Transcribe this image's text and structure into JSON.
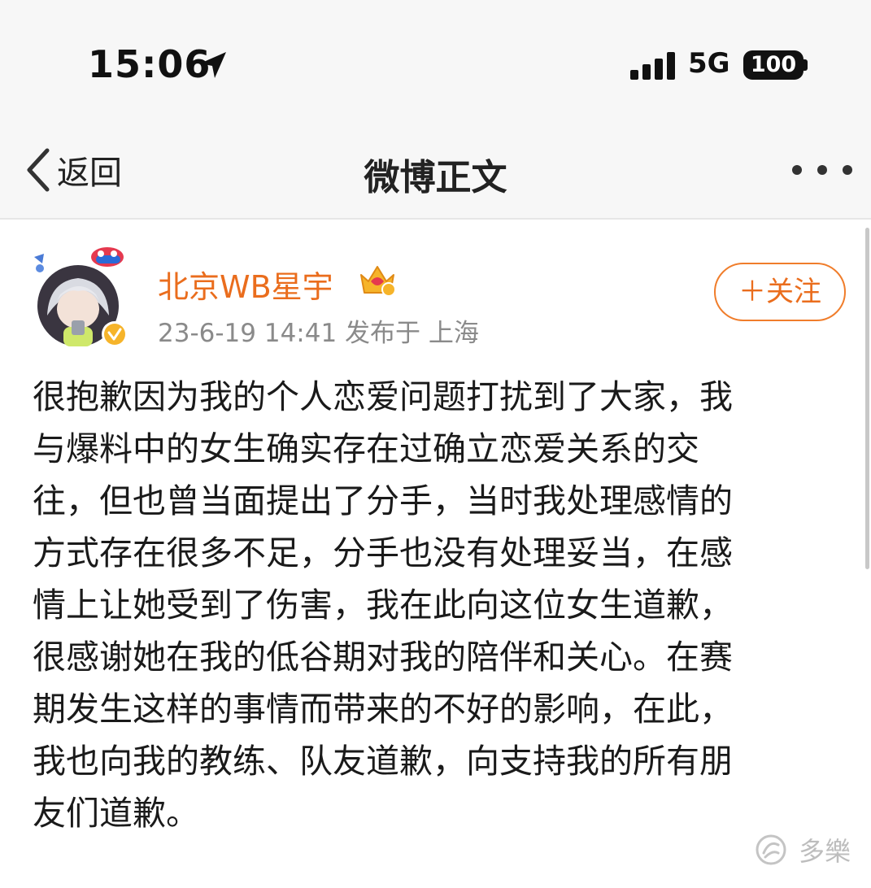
{
  "status_bar": {
    "time": "15:06",
    "network": "5G",
    "battery": "100"
  },
  "nav": {
    "back_label": "返回",
    "title": "微博正文"
  },
  "post": {
    "username": "北京WB星宇",
    "meta": "23-6-19 14:41  发布于 上海",
    "follow_label": "＋关注",
    "lines": [
      "很抱歉因为我的个人恋爱问题打扰到了大家，我",
      "与爆料中的女生确实存在过确立恋爱关系的交",
      "往，但也曾当面提出了分手，当时我处理感情的",
      "方式存在很多不足，分手也没有处理妥当，在感",
      "情上让她受到了伤害，我在此向这位女生道歉，",
      "很感谢她在我的低谷期对我的陪伴和关心。在赛",
      "期发生这样的事情而带来的不好的影响，在此，",
      "我也向我的教练、队友道歉，向支持我的所有朋",
      "友们道歉。"
    ]
  },
  "watermark": {
    "text": "多樂"
  },
  "colors": {
    "accent": "#ea6d1d",
    "meta_gray": "#8a8a8a",
    "header_bg": "#f7f7f7"
  },
  "icons": [
    "location-arrow-icon",
    "signal-icon",
    "battery-icon",
    "back-chevron-icon",
    "more-dots-icon",
    "crown-badge-icon",
    "verified-badge-icon",
    "watermark-logo-icon"
  ]
}
